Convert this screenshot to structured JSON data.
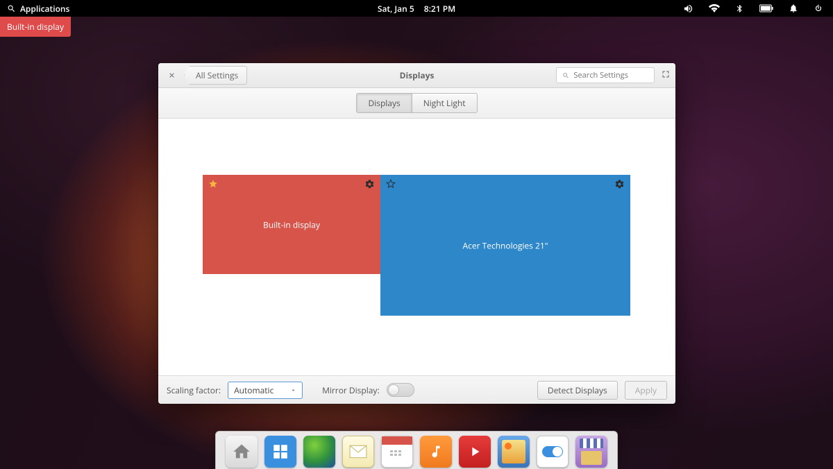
{
  "panel": {
    "applications_label": "Applications",
    "date": "Sat, Jan  5",
    "time": "8:21 PM"
  },
  "overlay": {
    "label": "Built-in display"
  },
  "window": {
    "close_tooltip": "Close",
    "back_label": "All Settings",
    "title": "Displays",
    "search_placeholder": "Search Settings",
    "tabs": {
      "displays": "Displays",
      "night_light": "Night Light"
    },
    "monitors": {
      "builtin": "Built-in display",
      "external": "Acer Technologies 21\""
    },
    "footer": {
      "scaling_label": "Scaling factor:",
      "scaling_value": "Automatic",
      "mirror_label": "Mirror Display:",
      "detect": "Detect Displays",
      "apply": "Apply"
    }
  },
  "dock": {
    "items": [
      "files",
      "multitasking",
      "web",
      "mail",
      "calendar",
      "music",
      "videos",
      "photos",
      "settings",
      "appcenter"
    ]
  }
}
